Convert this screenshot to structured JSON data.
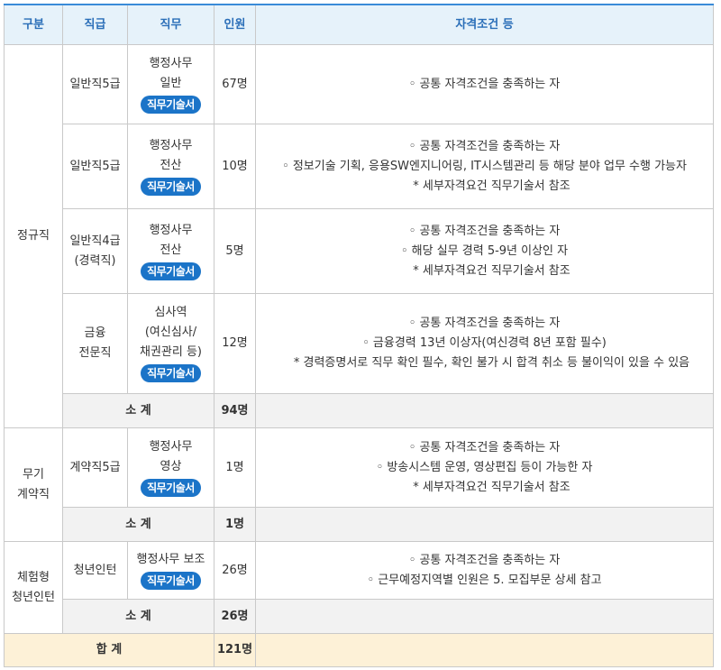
{
  "headers": {
    "category": "구분",
    "grade": "직급",
    "duty": "직무",
    "count": "인원",
    "qualifications": "자격조건 등"
  },
  "badge_label": "직무기술서",
  "sections": [
    {
      "category": "정규직",
      "rows": [
        {
          "grade": "일반직5급",
          "duty": [
            "행정사무",
            "일반"
          ],
          "count": "67명",
          "quals": [
            "◦ 공통 자격조건을 충족하는 자"
          ]
        },
        {
          "grade": "일반직5급",
          "duty": [
            "행정사무",
            "전산"
          ],
          "count": "10명",
          "quals": [
            "◦ 공통 자격조건을 충족하는 자",
            "◦ 정보기술 기획, 응용SW엔지니어링, IT시스템관리 등 해당 분야 업무 수행 가능자",
            "* 세부자격요건 직무기술서 참조"
          ]
        },
        {
          "grade": "일반직4급\n(경력직)",
          "duty": [
            "행정사무",
            "전산"
          ],
          "count": "5명",
          "quals": [
            "◦ 공통 자격조건을 충족하는 자",
            "◦ 해당 실무 경력 5-9년 이상인 자",
            "* 세부자격요건 직무기술서 참조"
          ]
        },
        {
          "grade": "금융\n전문직",
          "duty": [
            "심사역",
            "(여신심사/",
            "채권관리 등)"
          ],
          "count": "12명",
          "quals": [
            "◦ 공통 자격조건을 충족하는 자",
            "◦ 금융경력 13년 이상자(여신경력 8년 포함 필수)",
            "* 경력증명서로 직무 확인 필수, 확인 불가 시 합격 취소 등 불이익이 있을 수 있음"
          ]
        }
      ],
      "subtotal_label": "소 계",
      "subtotal": "94명"
    },
    {
      "category": "무기\n계약직",
      "rows": [
        {
          "grade": "계약직5급",
          "duty": [
            "행정사무",
            "영상"
          ],
          "count": "1명",
          "quals": [
            "◦ 공통 자격조건을 충족하는 자",
            "◦ 방송시스템 운영, 영상편집 등이 가능한 자",
            "* 세부자격요건 직무기술서 참조"
          ]
        }
      ],
      "subtotal_label": "소 계",
      "subtotal": "1명"
    },
    {
      "category": "체험형\n청년인턴",
      "rows": [
        {
          "grade": "청년인턴",
          "duty": [
            "행정사무 보조"
          ],
          "count": "26명",
          "quals": [
            "◦ 공통 자격조건을 충족하는 자",
            "◦ 근무예정지역별 인원은 5. 모집부문 상세 참고"
          ]
        }
      ],
      "subtotal_label": "소 계",
      "subtotal": "26명"
    }
  ],
  "total_label": "합 계",
  "total": "121명",
  "colors": {
    "header_bg": "#e6f2fa",
    "header_text": "#2a6eb8",
    "badge": "#1b74c8",
    "subtotal_bg": "#f2f2f2",
    "total_bg": "#fdf1d7"
  }
}
